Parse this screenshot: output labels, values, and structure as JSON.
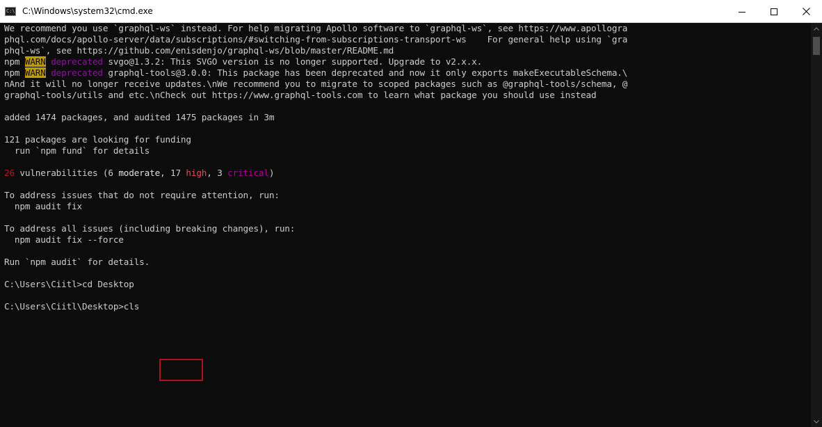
{
  "window": {
    "title": "C:\\Windows\\system32\\cmd.exe",
    "icon_text": "C:\\"
  },
  "terminal": {
    "lines": [
      "We recommend you use `graphql-ws` instead. For help migrating Apollo software to `graphql-ws`, see https://www.apollogra",
      "phql.com/docs/apollo-server/data/subscriptions/#switching-from-subscriptions-transport-ws    For general help using `gra",
      "phql-ws`, see https://github.com/enisdenjo/graphql-ws/blob/master/README.md",
      {
        "prefix": "npm ",
        "tag": "WARN",
        "status": " deprecated",
        "text": " svgo@1.3.2: This SVGO version is no longer supported. Upgrade to v2.x.x."
      },
      {
        "prefix": "npm ",
        "tag": "WARN",
        "status": " deprecated",
        "text": " graphql-tools@3.0.0: This package has been deprecated and now it only exports makeExecutableSchema.\\"
      },
      "nAnd it will no longer receive updates.\\nWe recommend you to migrate to scoped packages such as @graphql-tools/schema, @",
      "graphql-tools/utils and etc.\\nCheck out https://www.graphql-tools.com to learn what package you should use instead",
      "",
      "added 1474 packages, and audited 1475 packages in 3m",
      "",
      "121 packages are looking for funding",
      "  run `npm fund` for details",
      "",
      {
        "total": "26",
        "mid1": " vulnerabilities (6 ",
        "moderate": "moderate",
        "mid2": ", 17 ",
        "high": "high",
        "mid3": ", 3 ",
        "critical": "critical",
        "end": ")"
      },
      "",
      "To address issues that do not require attention, run:",
      "  npm audit fix",
      "",
      "To address all issues (including breaking changes), run:",
      "  npm audit fix --force",
      "",
      "Run `npm audit` for details.",
      "",
      "C:\\Users\\Ciitl>cd Desktop",
      "",
      {
        "prompt": "C:\\Users\\Ciitl\\Desktop>",
        "command": "cls"
      }
    ]
  }
}
